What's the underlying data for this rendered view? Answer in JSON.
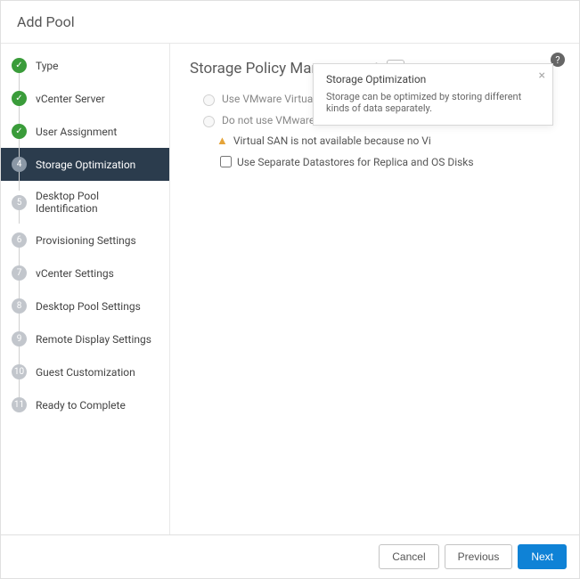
{
  "dialog": {
    "title": "Add Pool"
  },
  "steps": [
    {
      "label": "Type",
      "state": "done",
      "badge": "✓"
    },
    {
      "label": "vCenter Server",
      "state": "done",
      "badge": "✓"
    },
    {
      "label": "User Assignment",
      "state": "done",
      "badge": "✓"
    },
    {
      "label": "Storage Optimization",
      "state": "current",
      "badge": "4"
    },
    {
      "label": "Desktop Pool Identification",
      "state": "pending",
      "badge": "5"
    },
    {
      "label": "Provisioning Settings",
      "state": "pending",
      "badge": "6"
    },
    {
      "label": "vCenter Settings",
      "state": "pending",
      "badge": "7"
    },
    {
      "label": "Desktop Pool Settings",
      "state": "pending",
      "badge": "8"
    },
    {
      "label": "Remote Display Settings",
      "state": "pending",
      "badge": "9"
    },
    {
      "label": "Guest Customization",
      "state": "pending",
      "badge": "10"
    },
    {
      "label": "Ready to Complete",
      "state": "pending",
      "badge": "11"
    }
  ],
  "section": {
    "title": "Storage Policy Management",
    "info_glyph": "ⓘ"
  },
  "options": {
    "radio1": "Use VMware Virtual SAN",
    "radio2": "Do not use VMware Virtual SAN",
    "warning": "Virtual SAN is not available because no Vi",
    "checkbox": "Use Separate Datastores for Replica and OS Disks"
  },
  "tooltip": {
    "title": "Storage Optimization",
    "body": "Storage can be optimized by storing different kinds of data separately.",
    "close": "×"
  },
  "help": {
    "glyph": "?"
  },
  "footer": {
    "cancel": "Cancel",
    "previous": "Previous",
    "next": "Next"
  },
  "warn_glyph": "▲"
}
